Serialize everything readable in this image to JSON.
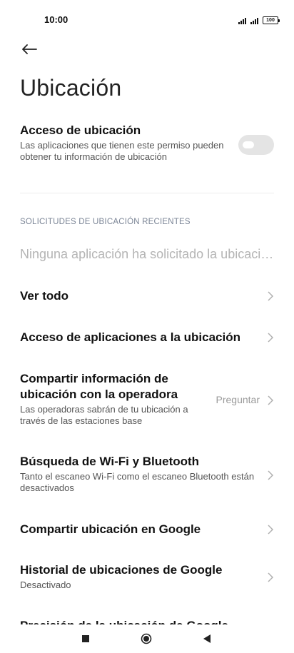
{
  "status_bar": {
    "time": "10:00",
    "battery": "100"
  },
  "header": {
    "title": "Ubicación"
  },
  "location_access": {
    "title": "Acceso de ubicación",
    "subtitle": "Las aplicaciones que tienen este permiso pueden obtener tu información de ubicación",
    "enabled": false
  },
  "recent_requests": {
    "header": "SOLICITUDES DE UBICACIÓN RECIENTES",
    "empty_text": "Ninguna aplicación ha solicitado la ubicación recientemente"
  },
  "items": [
    {
      "title": "Ver todo",
      "subtitle": "",
      "value": ""
    },
    {
      "title": "Acceso de aplicaciones a la ubicación",
      "subtitle": "",
      "value": ""
    },
    {
      "title": "Compartir información de ubicación con la operadora",
      "subtitle": "Las operadoras sabrán de tu ubicación a través de las estaciones base",
      "value": "Preguntar"
    },
    {
      "title": "Búsqueda de Wi-Fi y Bluetooth",
      "subtitle": "Tanto el escaneo Wi-Fi como el escaneo Bluetooth están desactivados",
      "value": ""
    },
    {
      "title": "Compartir ubicación en Google",
      "subtitle": "",
      "value": ""
    },
    {
      "title": "Historial de ubicaciones de Google",
      "subtitle": "Desactivado",
      "value": ""
    },
    {
      "title": "Precisión de la ubicación de Google",
      "subtitle": "",
      "value": ""
    }
  ],
  "icons": {
    "back": "arrow-left-icon",
    "chevron": "chevron-right-icon",
    "nav_recents": "square-icon",
    "nav_home": "circle-icon",
    "nav_back": "triangle-left-icon"
  },
  "colors": {
    "text_primary": "#111111",
    "text_secondary": "#555555",
    "muted": "#b4b4b4",
    "section_header": "#7b8596",
    "toggle_off": "#e4e4e4"
  }
}
